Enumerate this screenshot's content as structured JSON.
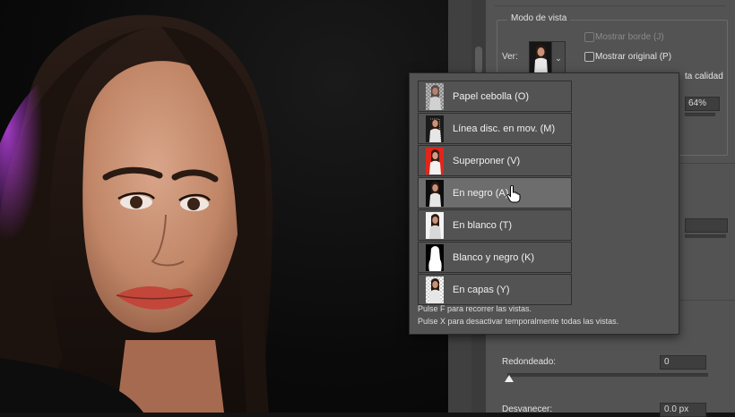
{
  "panel": {
    "group_title": "Modo de vista",
    "ver_label": "Ver:",
    "show_edge_label": "Mostrar borde (J)",
    "show_original_label": "Mostrar original (P)",
    "high_quality_label": "ta calidad",
    "opacity_value": "64%",
    "smooth_label": "Redondeado:",
    "smooth_value": "0",
    "feather_label": "Desvanecer:",
    "feather_value": "0.0 px"
  },
  "view_menu": {
    "items": [
      {
        "label": "Papel cebolla (O)",
        "icon": "onion-skin-thumbnail-icon"
      },
      {
        "label": "Línea disc. en mov. (M)",
        "icon": "marching-ants-thumbnail-icon"
      },
      {
        "label": "Superponer (V)",
        "icon": "overlay-thumbnail-icon"
      },
      {
        "label": "En negro (A)",
        "icon": "on-black-thumbnail-icon",
        "selected": true
      },
      {
        "label": "En blanco (T)",
        "icon": "on-white-thumbnail-icon"
      },
      {
        "label": "Blanco y negro (K)",
        "icon": "black-white-thumbnail-icon"
      },
      {
        "label": "En capas (Y)",
        "icon": "on-layers-thumbnail-icon"
      }
    ],
    "hint1": "Pulse F para recorrer las vistas.",
    "hint2": "Pulse X para desactivar temporalmente todas las vistas."
  },
  "colors": {
    "panel_bg": "#535353",
    "popup_active": "#6d6d6d",
    "overlay_red": "#e0261c"
  }
}
